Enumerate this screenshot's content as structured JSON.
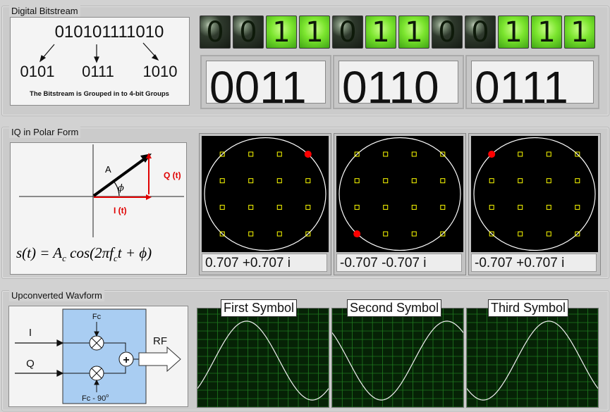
{
  "colors": {
    "bit_on": "#7be52e",
    "bit_off": "#2a3328",
    "plot_bg": "#000000",
    "grid_green": "#1f7a1f",
    "ref_point": "#ffff00",
    "symbol_dot": "#ff0000",
    "circle": "#ffffff",
    "iq_box": "#a9cdf2",
    "diagram_red": "#e00000"
  },
  "sections": {
    "bitstream": "Digital Bitstream",
    "polar": "IQ in Polar Form",
    "upconverted": "Upconverted Wavform"
  },
  "bitstream_diagram": {
    "stream": "010101111010",
    "groups": [
      "0101",
      "0111",
      "1010"
    ],
    "caption": "The Bitstream is Grouped in to 4-bit Groups"
  },
  "bits": [
    "0",
    "0",
    "1",
    "1",
    "0",
    "1",
    "1",
    "0",
    "0",
    "1",
    "1",
    "1"
  ],
  "groups": [
    "0011",
    "0110",
    "0111"
  ],
  "polar_diagram": {
    "amplitude": "A",
    "phase": "ϕ",
    "q_label": "Q (t)",
    "i_label": "I (t)",
    "formula": "s(t) = A",
    "formula_c": "c",
    "formula_mid": " cos(2πf",
    "formula_c2": "c",
    "formula_end": "t + ϕ)"
  },
  "constellations": [
    {
      "value": "0.707 +0.707 i",
      "point": {
        "i": 0.707,
        "q": 0.707
      }
    },
    {
      "value": "-0.707 -0.707 i",
      "point": {
        "i": -0.707,
        "q": -0.707
      }
    },
    {
      "value": "-0.707 +0.707 i",
      "point": {
        "i": -0.707,
        "q": 0.707
      }
    }
  ],
  "modulator": {
    "i": "I",
    "q": "Q",
    "fc": "Fc",
    "fc90": "Fc - 90",
    "deg": "o",
    "plus": "+",
    "rf": "RF"
  },
  "waveforms": [
    {
      "title": "First Symbol",
      "phase_deg": 45
    },
    {
      "title": "Second Symbol",
      "phase_deg": 225
    },
    {
      "title": "Third Symbol",
      "phase_deg": 135
    }
  ]
}
